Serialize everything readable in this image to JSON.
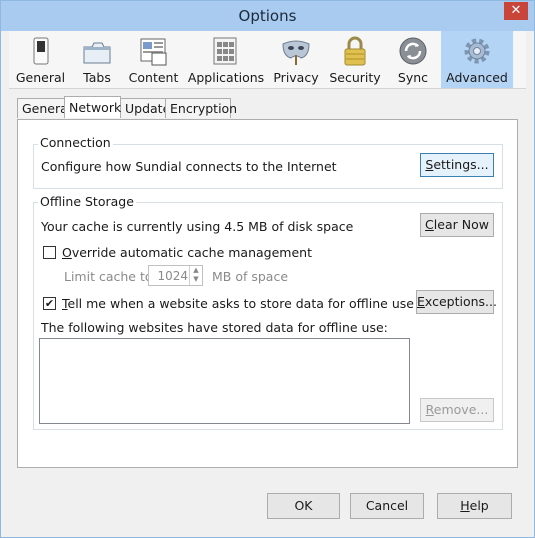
{
  "window": {
    "title": "Options",
    "close_glyph": "✕"
  },
  "toolbar": {
    "items": [
      {
        "label": "General",
        "icon": "switch-icon"
      },
      {
        "label": "Tabs",
        "icon": "tabs-icon"
      },
      {
        "label": "Content",
        "icon": "content-icon"
      },
      {
        "label": "Applications",
        "icon": "applications-icon"
      },
      {
        "label": "Privacy",
        "icon": "mask-icon"
      },
      {
        "label": "Security",
        "icon": "padlock-icon"
      },
      {
        "label": "Sync",
        "icon": "sync-icon"
      },
      {
        "label": "Advanced",
        "icon": "gear-icon",
        "selected": true
      }
    ]
  },
  "tabs": [
    {
      "label": "General"
    },
    {
      "label": "Network",
      "selected": true
    },
    {
      "label": "Update"
    },
    {
      "label": "Encryption"
    }
  ],
  "connection": {
    "title": "Connection",
    "description": "Configure how Sundial connects to the Internet",
    "settings_prefix": "",
    "settings_underline": "S",
    "settings_rest": "ettings..."
  },
  "offline": {
    "title": "Offline Storage",
    "cache_text": "Your cache is currently using 4.5 MB of disk space",
    "clear_underline": "C",
    "clear_rest": "lear Now",
    "override_underline": "O",
    "override_rest": "verride automatic cache management",
    "override_checked": false,
    "limit_label": "Limit cache to",
    "limit_value": "1024",
    "limit_unit": "MB of space",
    "tell_underline": "T",
    "tell_rest": "ell me when a website asks to store data for offline use",
    "tell_checked": true,
    "tell_check_glyph": "✔",
    "exceptions_prefix": "",
    "exceptions_underline": "E",
    "exceptions_rest": "xceptions...",
    "websites_label": "The following websites have stored data for offline use:",
    "websites_list": [],
    "remove_underline": "R",
    "remove_rest": "emove..."
  },
  "footer": {
    "ok_label": "OK",
    "cancel_label": "Cancel",
    "help_underline": "H",
    "help_rest": "elp"
  },
  "colors": {
    "title_bar": "#a9cbf0",
    "selected_toolbar": "#b3d4f5",
    "close_button": "#c9453a"
  }
}
